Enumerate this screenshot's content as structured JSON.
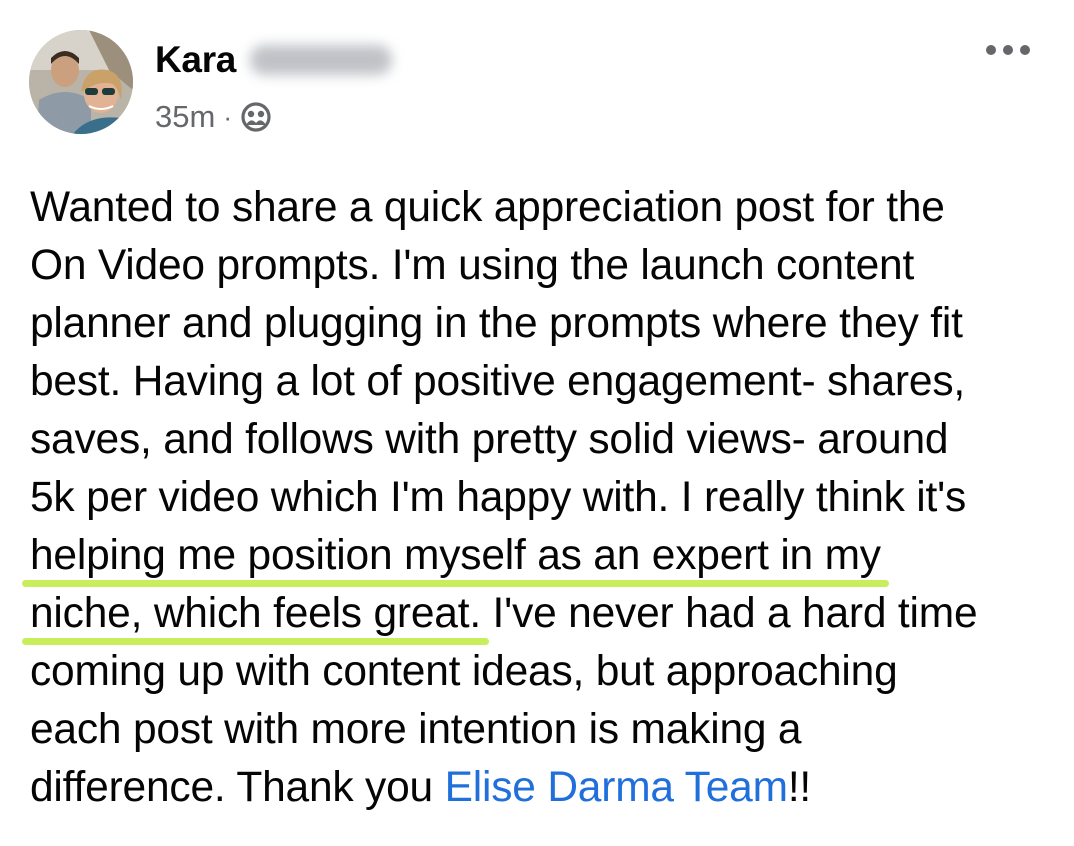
{
  "post": {
    "author": {
      "first_name": "Kara",
      "last_name_blurred": true,
      "avatar": "couple-selfie-photo"
    },
    "timestamp": "35m",
    "separator": "·",
    "audience_icon": "group-icon",
    "more_icon": "more-horizontal-icon",
    "body_lines": [
      "Wanted to share a quick appreciation post for the",
      "On Video prompts. I'm using the launch content",
      "planner and plugging in the prompts where they fit",
      "best. Having a lot of positive engagement- shares,",
      "saves, and follows with pretty solid views- around",
      "5k per video which I'm happy with. I really think it's"
    ],
    "highlight_line_1": "helping me position myself as an expert in my",
    "highlight_line_2": "niche, which feels great.",
    "line_after_highlight": " I've never had a hard time",
    "body_lines_end": [
      "coming up with content ideas, but approaching",
      "each post with more intention is making a"
    ],
    "final_line_prefix": "difference. Thank you ",
    "mention": "Elise Darma Team",
    "final_line_suffix": "!!",
    "colors": {
      "text": "#050505",
      "meta": "#65676b",
      "mention": "#216fdb",
      "highlight_underline": "#c8ef5b"
    }
  }
}
